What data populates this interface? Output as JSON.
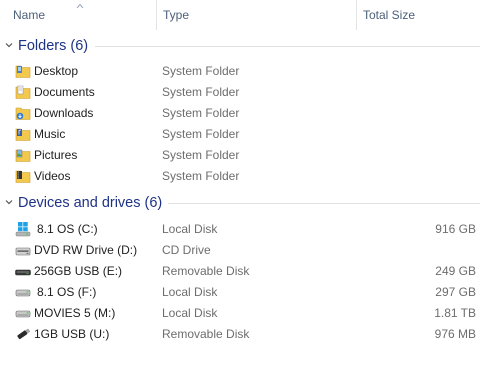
{
  "columns": {
    "name": "Name",
    "type": "Type",
    "total_size": "Total Size"
  },
  "folders_group": {
    "title": "Folders (6)",
    "items": [
      {
        "name": "Desktop",
        "type": "System Folder",
        "icon": "desktop-folder-icon"
      },
      {
        "name": "Documents",
        "type": "System Folder",
        "icon": "documents-folder-icon"
      },
      {
        "name": "Downloads",
        "type": "System Folder",
        "icon": "downloads-folder-icon"
      },
      {
        "name": "Music",
        "type": "System Folder",
        "icon": "music-folder-icon"
      },
      {
        "name": "Pictures",
        "type": "System Folder",
        "icon": "pictures-folder-icon"
      },
      {
        "name": "Videos",
        "type": "System Folder",
        "icon": "videos-folder-icon"
      }
    ]
  },
  "drives_group": {
    "title": "Devices and drives (6)",
    "items": [
      {
        "name": "8.1 OS (C:)",
        "type": "Local Disk",
        "size": "916 GB",
        "icon": "windows-drive-icon"
      },
      {
        "name": "DVD RW Drive (D:)",
        "type": "CD Drive",
        "size": "",
        "icon": "dvd-drive-icon"
      },
      {
        "name": "256GB USB (E:)",
        "type": "Removable Disk",
        "size": "249 GB",
        "icon": "removable-disk-icon"
      },
      {
        "name": "8.1 OS (F:)",
        "type": "Local Disk",
        "size": "297 GB",
        "icon": "local-disk-icon"
      },
      {
        "name": "MOVIES 5 (M:)",
        "type": "Local Disk",
        "size": "1.81 TB",
        "icon": "local-disk-icon"
      },
      {
        "name": "1GB USB (U:)",
        "type": "Removable Disk",
        "size": "976 MB",
        "icon": "usb-stick-icon"
      }
    ]
  },
  "colors": {
    "group_title": "#1e3287",
    "header_text": "#4c607a",
    "secondary_text": "#6d6d6d",
    "folder_yellow": "#f2c94c"
  }
}
